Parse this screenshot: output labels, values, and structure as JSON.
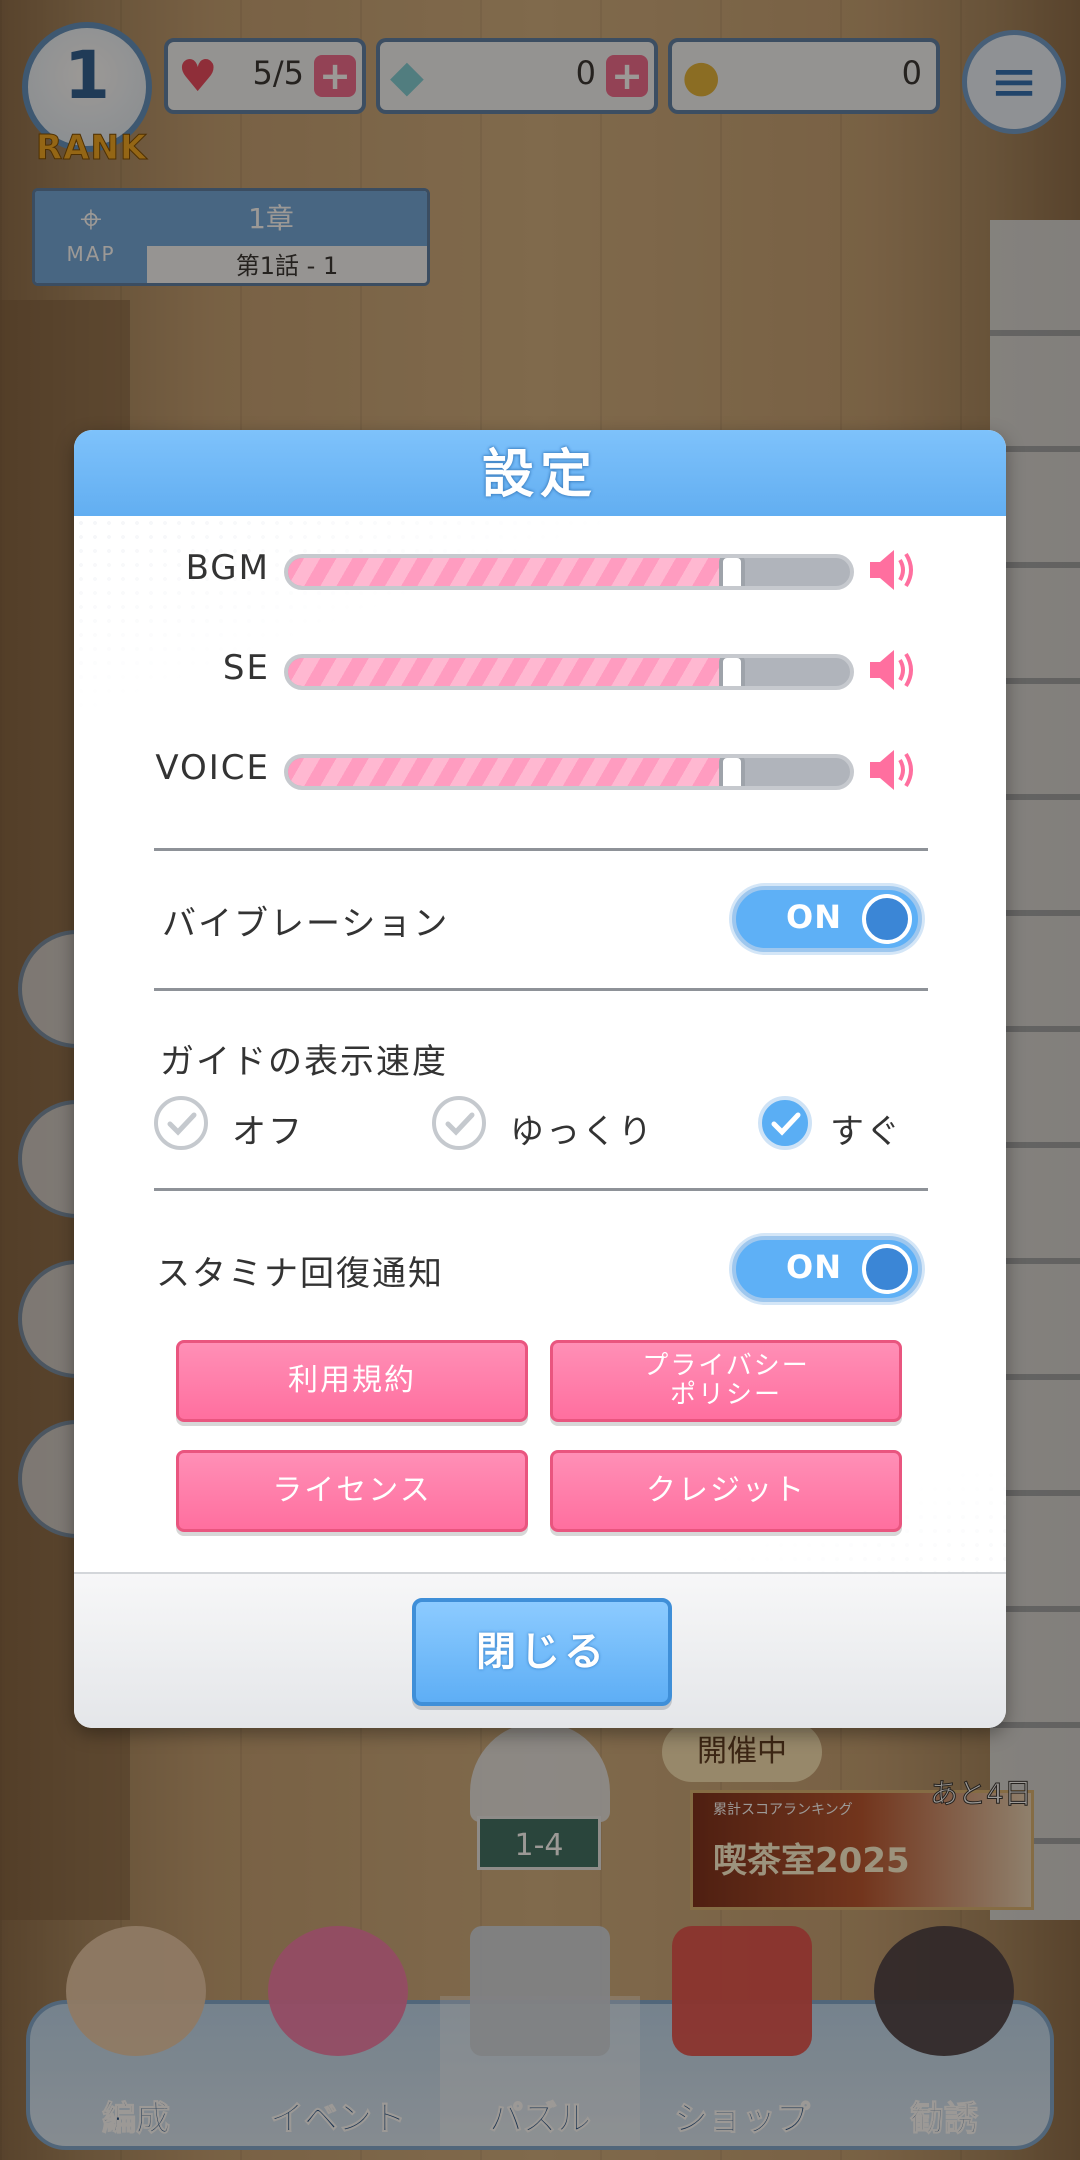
{
  "hud": {
    "rank_number": "1",
    "rank_label": "RANK",
    "stamina": "5/5",
    "gems": "0",
    "coins": "0"
  },
  "map_card": {
    "map_label": "MAP",
    "chapter": "1章",
    "episode": "第1話 - 1"
  },
  "scene": {
    "stage_tag": "1-4",
    "event_status": "開催中",
    "event_remaining": "あと4日",
    "event_banner_small": "累計スコアランキング",
    "event_banner_title": "喫茶室2025"
  },
  "settings": {
    "title": "設定",
    "sliders": [
      {
        "label": "BGM",
        "level": 0.79
      },
      {
        "label": "SE",
        "level": 0.79
      },
      {
        "label": "VOICE",
        "level": 0.79
      }
    ],
    "vibration": {
      "label": "バイブレーション",
      "state": "ON"
    },
    "guide_speed": {
      "label": "ガイドの表示速度",
      "options": [
        "オフ",
        "ゆっくり",
        "すぐ"
      ],
      "selected": "すぐ"
    },
    "stamina_notify": {
      "label": "スタミナ回復通知",
      "state": "ON"
    },
    "buttons": {
      "terms": "利用規約",
      "privacy_line1": "プライバシー",
      "privacy_line2": "ポリシー",
      "license": "ライセンス",
      "credits": "クレジット"
    },
    "close": "閉じる"
  },
  "nav": {
    "items": [
      "編成",
      "イベント",
      "パズル",
      "ショップ",
      "勧誘"
    ],
    "active": "パズル"
  },
  "colors": {
    "accent_blue": "#62aef1",
    "pink": "#ff6f9f",
    "toggle_on": "#5eb0f6"
  }
}
